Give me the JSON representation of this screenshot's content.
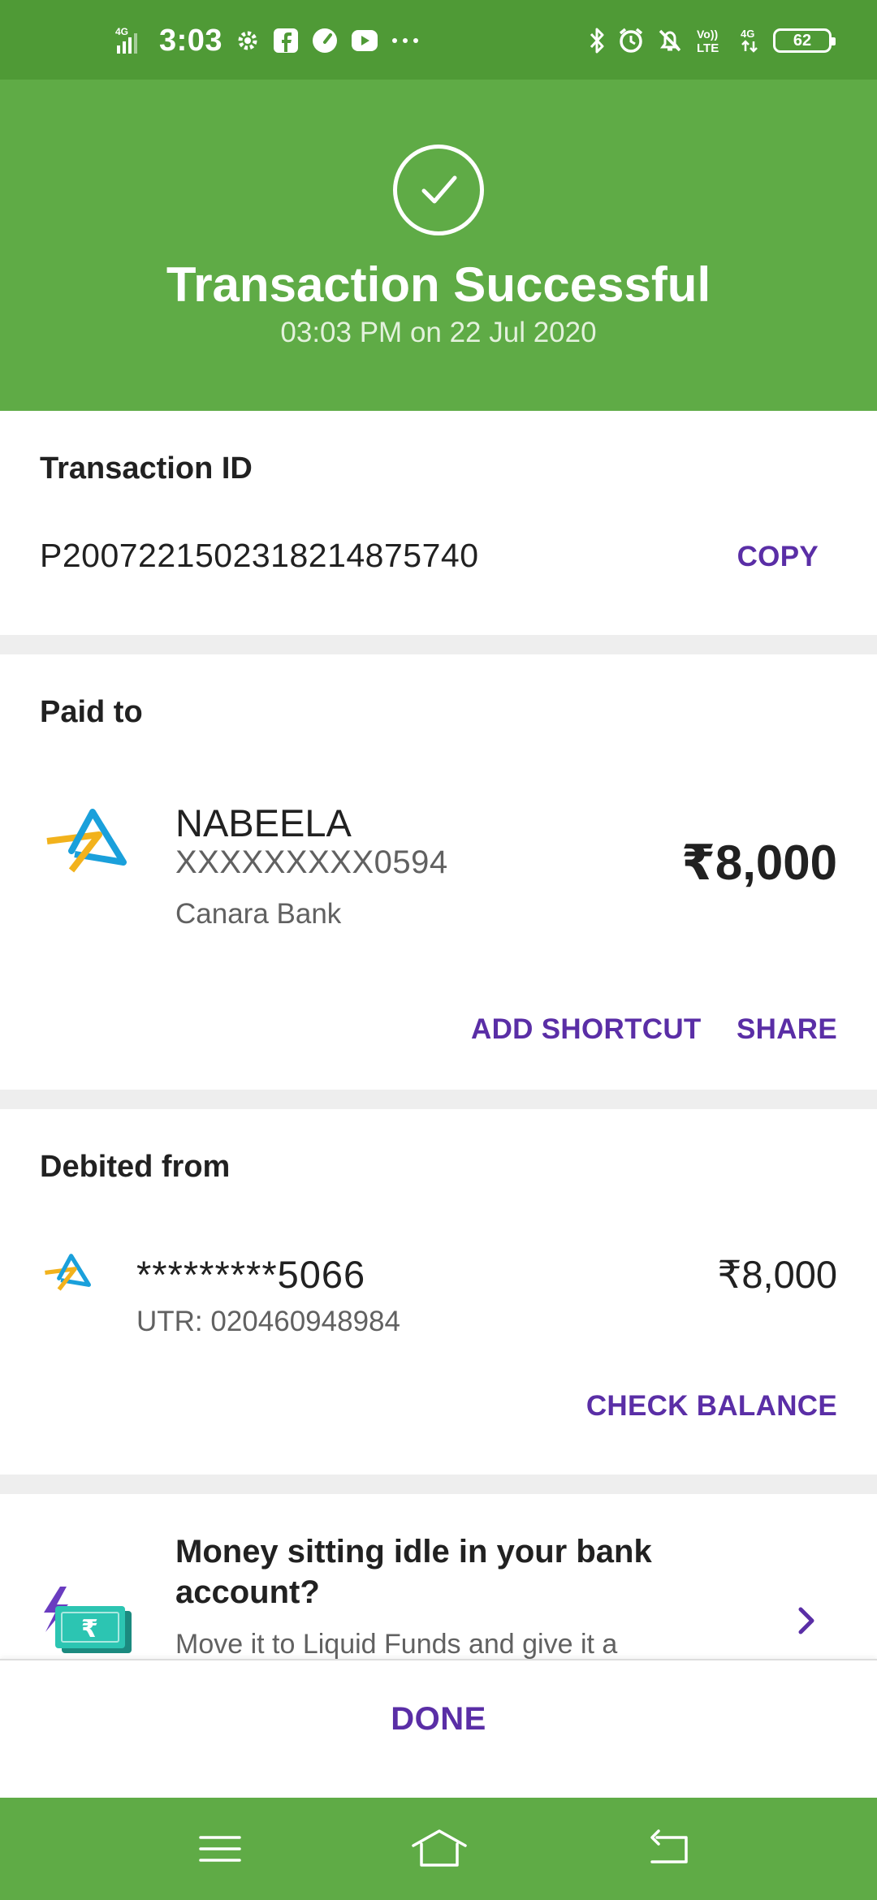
{
  "status_bar": {
    "network_left": "4G",
    "time": "3:03",
    "volte": "Vo)) LTE",
    "network_right": "4G",
    "battery": "62"
  },
  "header": {
    "title": "Transaction Successful",
    "subtitle": "03:03 PM on 22 Jul 2020",
    "bg_color": "#5fab46"
  },
  "transaction": {
    "label": "Transaction ID",
    "id": "P2007221502318214875740",
    "copy_label": "COPY"
  },
  "paid_to": {
    "label": "Paid to",
    "name": "NABEELA",
    "account": "XXXXXXXXX0594",
    "bank": "Canara Bank",
    "amount": "₹8,000",
    "add_shortcut_label": "ADD SHORTCUT",
    "share_label": "SHARE",
    "icon": "bank-logo-icon"
  },
  "debited_from": {
    "label": "Debited from",
    "account": "*********5066",
    "utr": "UTR: 020460948984",
    "amount": "₹8,000",
    "check_balance_label": "CHECK BALANCE",
    "icon": "bank-logo-icon"
  },
  "promo": {
    "title": "Money sitting idle in your bank account?",
    "description": "Move it to Liquid Funds and give it a",
    "icon": "rupee-cash-icon"
  },
  "footer": {
    "done_label": "DONE"
  },
  "nav": {
    "items": [
      "menu-icon",
      "home-icon",
      "back-icon"
    ]
  },
  "colors": {
    "accent": "#5a2ea6",
    "status_bar": "#4f9a36"
  }
}
